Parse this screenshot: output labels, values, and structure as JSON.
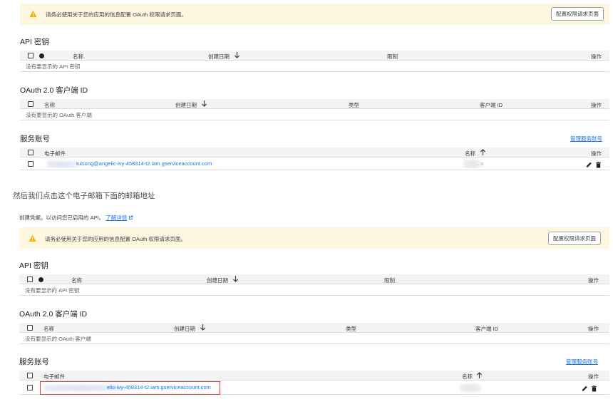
{
  "banner": {
    "text": "请务必使用关于您的应用的信息配置 OAuth 权限请求页面。",
    "button": "配置权限请求页面"
  },
  "api_keys": {
    "title": "API 密钥",
    "columns": {
      "name": "名称",
      "created": "创建日期",
      "restrictions": "限制",
      "actions": "操作"
    },
    "empty": "没有要显示的 API 密钥"
  },
  "oauth": {
    "title": "OAuth 2.0 客户端 ID",
    "columns": {
      "name": "名称",
      "created": "创建日期",
      "type": "类型",
      "client_id": "客户端 ID",
      "actions": "操作"
    },
    "empty": "没有要显示的 OAuth 客户端"
  },
  "service_accounts": {
    "title": "服务账号",
    "manage": "管理服务账号",
    "columns": {
      "email": "电子邮件",
      "name": "名称",
      "actions": "操作"
    },
    "row1": {
      "email": "tuisong@angelic-ivy-458314-t2.iam.gserviceaccount.com",
      "name": "...s"
    },
    "row2": {
      "email": "elic-ivy-458314-t2.iam.gserviceaccount.com"
    }
  },
  "caption": "然后我们点击这个电子邮箱下面的邮箱地址",
  "note": {
    "text": "创建凭据，以访问您已启用的 API。",
    "link": "了解详情"
  },
  "colors": {
    "accent": "#1a73e8",
    "warning": "#f9ab00",
    "banner_bg": "#fef7e0",
    "highlight": "#e53935"
  },
  "icons": [
    "warning-icon",
    "arrow-down-icon",
    "arrow-up-icon",
    "edit-icon",
    "delete-icon",
    "external-link-icon"
  ]
}
